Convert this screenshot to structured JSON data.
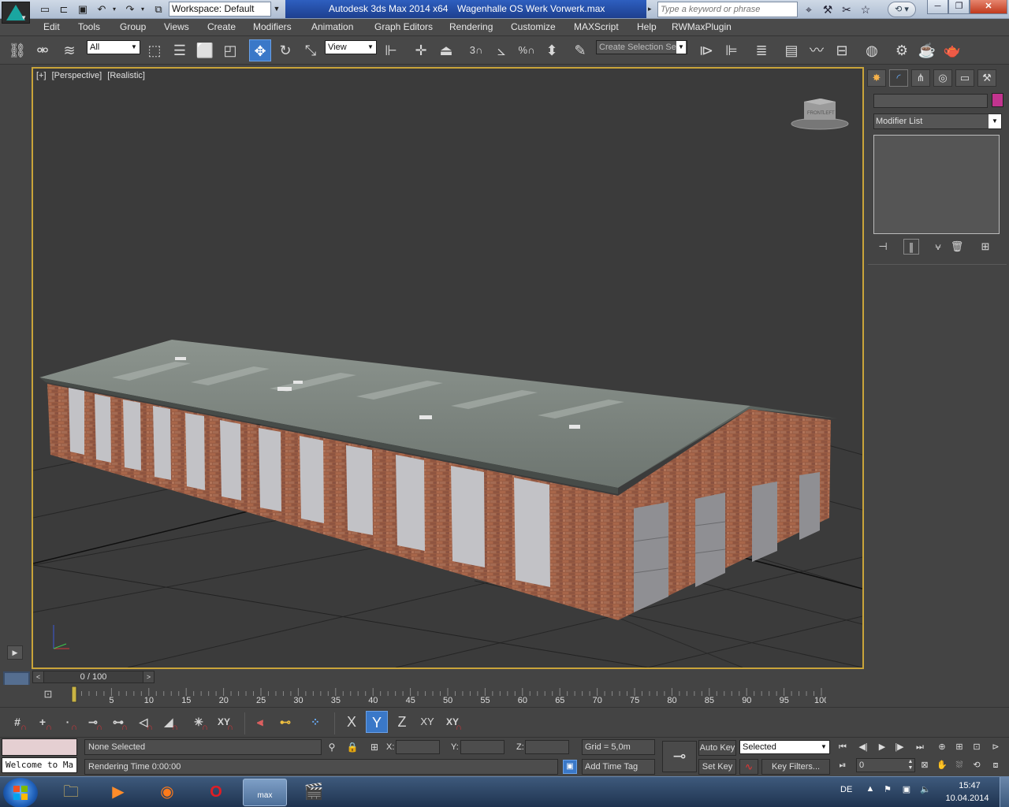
{
  "titlebar": {
    "workspace": "Workspace: Default",
    "app_title": "Autodesk 3ds Max  2014 x64",
    "file_name": "Wagenhalle OS Werk Vorwerk.max",
    "search_placeholder": "Type a keyword or phrase"
  },
  "menu": [
    "Edit",
    "Tools",
    "Group",
    "Views",
    "Create",
    "Modifiers",
    "Animation",
    "Graph Editors",
    "Rendering",
    "Customize",
    "MAXScript",
    "Help",
    "RWMaxPlugin"
  ],
  "toolbar": {
    "selection_filter": "All",
    "ref_coord": "View",
    "named_selection_placeholder": "Create Selection Se",
    "angle_snap_label": "3",
    "percent_snap_label": "%"
  },
  "viewport": {
    "label_plus": "[+]",
    "label_view": "[Perspective]",
    "label_shading": "[Realistic]",
    "viewcube_front": "FRONT",
    "viewcube_left": "LEFT"
  },
  "command_panel": {
    "modifier_list": "Modifier List",
    "object_color": "#c2348f"
  },
  "timeline": {
    "slider_label": "0 / 100",
    "ticks": [
      "5",
      "10",
      "15",
      "20",
      "25",
      "30",
      "35",
      "40",
      "45",
      "50",
      "55",
      "60",
      "65",
      "70",
      "75",
      "80",
      "85",
      "90",
      "95",
      "100"
    ]
  },
  "snapbar": {
    "axis_x": "X",
    "axis_y": "Y",
    "axis_z": "Z",
    "axis_xy": "XY",
    "axis_xy2": "XY"
  },
  "status": {
    "listener_text": "Welcome to Ma",
    "selection": "None Selected",
    "rendering_time": "Rendering Time  0:00:00",
    "x_label": "X:",
    "y_label": "Y:",
    "z_label": "Z:",
    "grid": "Grid = 5,0m",
    "add_time_tag": "Add Time Tag",
    "auto_key": "Auto Key",
    "set_key": "Set Key",
    "key_mode": "Selected",
    "key_filters": "Key Filters...",
    "frame": "0"
  },
  "taskbar": {
    "language": "DE",
    "time": "15:47",
    "date": "10.04.2014",
    "max_app_label": "max"
  },
  "colors": {
    "viewport_border": "#c9a43a",
    "active_tool": "#3a78c8"
  }
}
